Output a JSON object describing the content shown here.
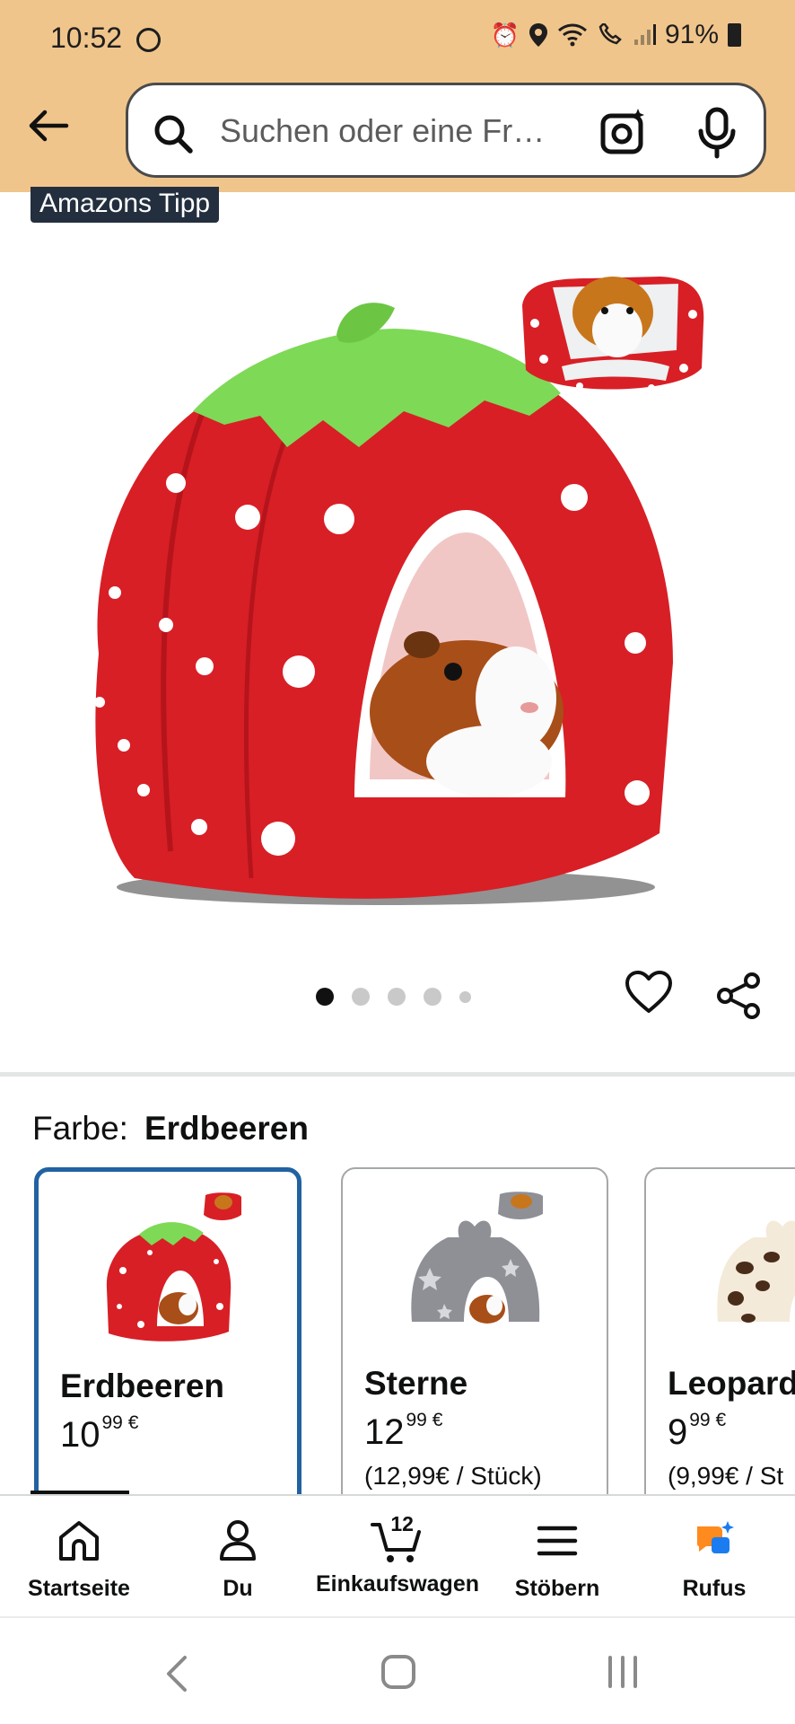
{
  "status_bar": {
    "time": "10:52",
    "battery": "91%",
    "icons": [
      "circle-icon",
      "alarm-icon",
      "location-icon",
      "wifi-icon",
      "wifi-call-icon",
      "signal-icon",
      "battery-icon"
    ]
  },
  "header": {
    "search_placeholder": "Suchen oder eine Fr…",
    "background_color": "#f0c58c"
  },
  "product": {
    "badge": "Amazons Tipp",
    "image_count": 5,
    "active_image_index": 0
  },
  "color_selector": {
    "label": "Farbe:",
    "selected": "Erdbeeren",
    "options": [
      {
        "name": "Erdbeeren",
        "price_whole": "10",
        "price_fraction": "99",
        "currency": "€",
        "unit_price": ""
      },
      {
        "name": "Sterne",
        "price_whole": "12",
        "price_fraction": "99",
        "currency": "€",
        "unit_price": "(12,99€ / Stück)"
      },
      {
        "name": "Leopard",
        "price_whole": "9",
        "price_fraction": "99",
        "currency": "€",
        "unit_price": "(9,99€ / St"
      }
    ]
  },
  "bottom_nav": {
    "items": [
      {
        "label": "Startseite",
        "icon": "home-icon"
      },
      {
        "label": "Du",
        "icon": "user-icon"
      },
      {
        "label": "Einkaufswagen",
        "icon": "cart-icon",
        "badge": "12"
      },
      {
        "label": "Stöbern",
        "icon": "menu-icon"
      },
      {
        "label": "Rufus",
        "icon": "rufus-icon"
      }
    ]
  },
  "colors": {
    "accent_selected": "#2162a1",
    "strawberry_red": "#d81f26",
    "leaf_green": "#7ed957",
    "rufus_orange": "#ff8a1e",
    "rufus_blue": "#1b7cf2"
  }
}
